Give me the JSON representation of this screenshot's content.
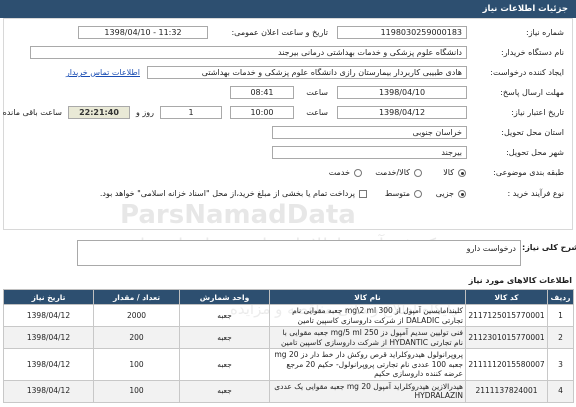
{
  "page_title": "جزئیات اطلاعات نیاز",
  "form": {
    "need_number_label": "شماره نیاز:",
    "need_number": "1198030259000183",
    "announce_label": "تاریخ و ساعت اعلان عمومی:",
    "announce_value": "1398/04/10 - 11:32",
    "buyer_label": "نام دستگاه خریدار:",
    "buyer_value": "دانشگاه علوم پزشکی و خدمات بهداشتی درمانی بیرجند",
    "creator_label": "ایجاد کننده درخواست:",
    "creator_value": "هادی طبیبی کاربردار بیمارستان رازی دانشگاه علوم پزشکی و خدمات بهداشتی",
    "contact_link": "اطلاعات تماس خریدار",
    "reply_deadline_label": "مهلت ارسال پاسخ:",
    "reply_date": "1398/04/10",
    "reply_time_label": "ساعت",
    "reply_time": "08:41",
    "validity_label": "تاریخ اعتبار نیاز:",
    "validity_date": "1398/04/12",
    "validity_time_label": "ساعت",
    "validity_time": "10:00",
    "remaining_days": "1",
    "remaining_days_label": "روز و",
    "remaining_time": "22:21:40",
    "remaining_time_label": "ساعت باقی مانده",
    "province_label": "استان محل تحویل:",
    "province_value": "خراسان جنوبی",
    "city_label": "شهر محل تحویل:",
    "city_value": "بیرجند",
    "category_label": "طبقه بندی موضوعی:",
    "category_options": [
      "کالا",
      "کالا/خدمت",
      "خدمت"
    ],
    "process_label": "نوع فرآیند خرید :",
    "process_options": [
      "جزیی",
      "متوسط"
    ],
    "treasury_note": "پرداخت تمام یا بخشی از مبلغ خرید،از محل \"اسناد خزانه اسلامی\" خواهد بود."
  },
  "description": {
    "label": "شرح کلی نیاز:",
    "value": "درخواست دارو"
  },
  "watermark": {
    "line1": "ParsNamadData",
    "line2": "مرکز فن آوری اطلاعات پارس نماد داده ها",
    "line3": "پایگاه اطلاع رسانی مناقصه و مزایده"
  },
  "goods": {
    "section_title": "اطلاعات کالاهای مورد نیاز",
    "columns": [
      "ردیف",
      "کد کالا",
      "نام کالا",
      "واحد شمارش",
      "تعداد / مقدار",
      "تاریخ نیاز"
    ],
    "rows": [
      [
        "1",
        "2117125015770001",
        "کلیندامایسین آمپول از 300 mg\\2 ml جعبه مقوایی نام تجارتی DALADIC از شرکت داروسازی کاسپین تامین",
        "جعبه",
        "2000",
        "1398/04/12"
      ],
      [
        "2",
        "2112301015770001",
        "فنی تولیین سدیم آمپول دز 250 mg/5 ml جعبه مقوایی با نام تجارتی HYDANTIC از شرکت داروسازی کاسپین تامین",
        "جعبه",
        "200",
        "1398/04/12"
      ],
      [
        "3",
        "2111112015580007",
        "پروپرانولول هیدروکلراید قرص روکش دار خط دار دز 20 mg جعبه 100 عددی نام تجارتی پروپرانولول- حکیم 20 مرجع عرضه کننده داروسازی حکیم",
        "جعبه",
        "100",
        "1398/04/12"
      ],
      [
        "4",
        "2111137824001",
        "هیدرالازین هیدروکلراید آمپول 20 mg جعبه مقوایی یک عددی HYDRALAZIN",
        "جعبه",
        "100",
        "1398/04/12"
      ]
    ]
  }
}
